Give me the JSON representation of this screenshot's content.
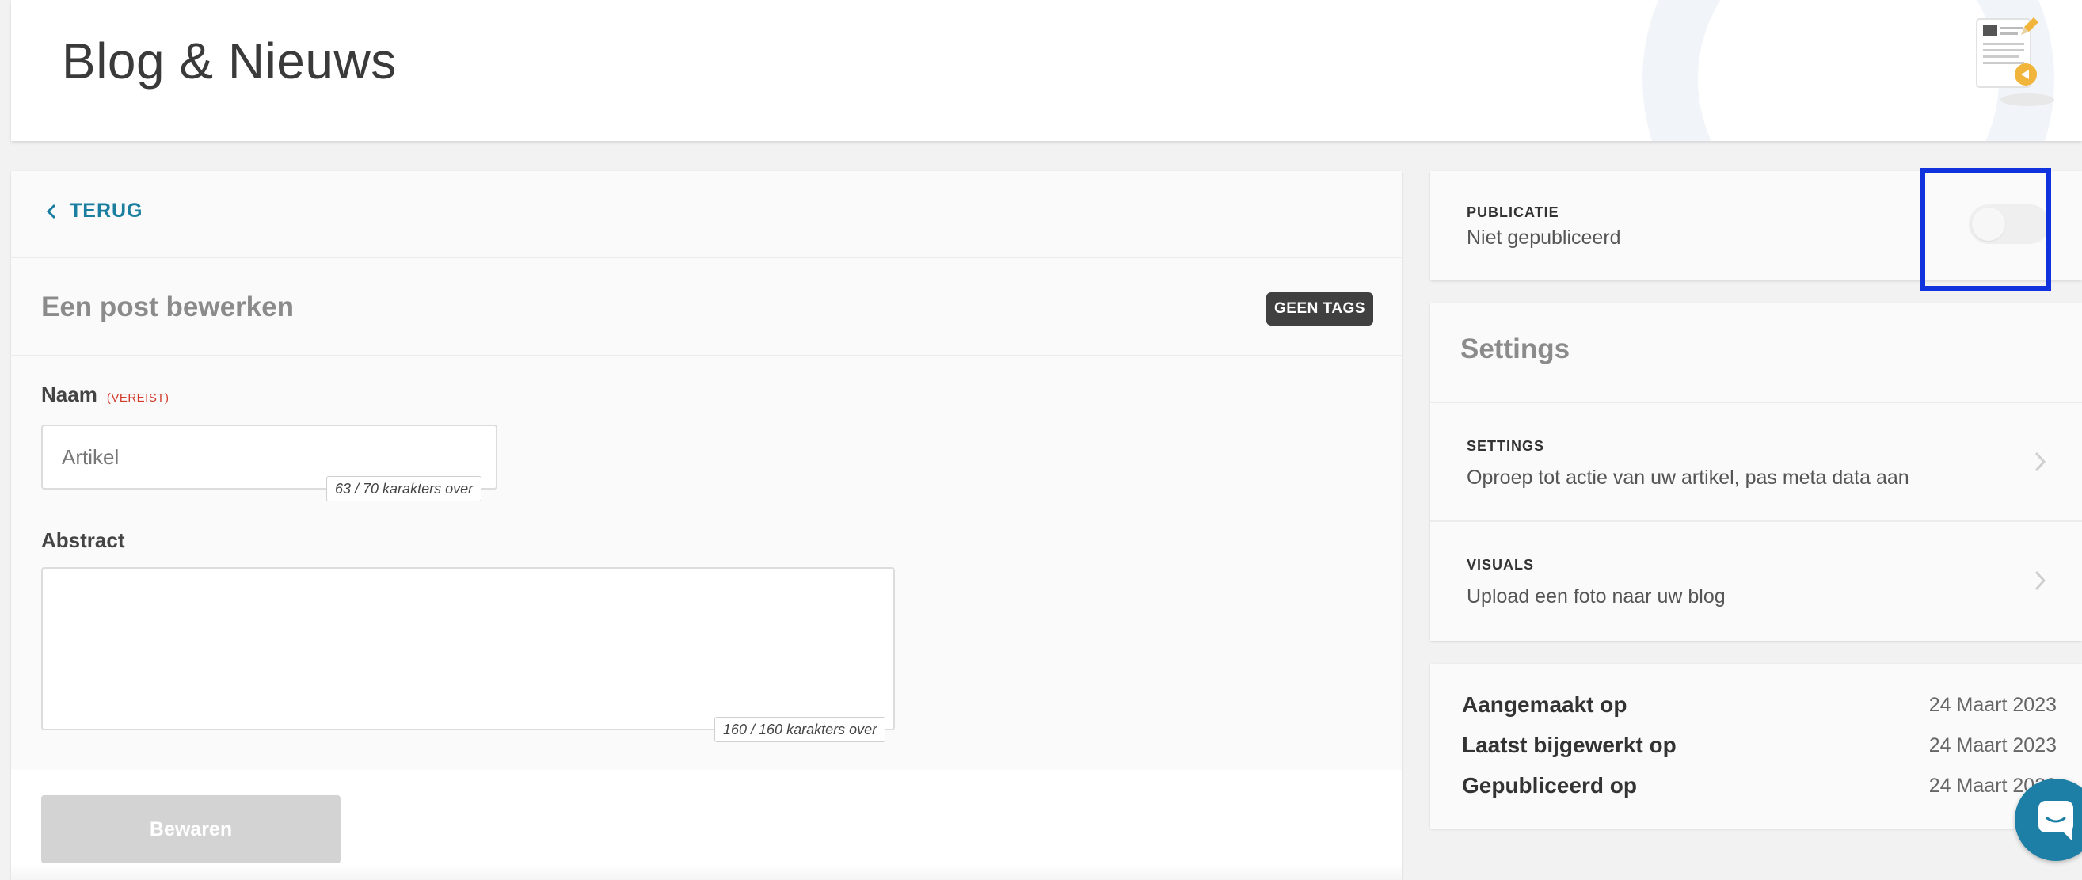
{
  "header": {
    "title": "Blog & Nieuws",
    "logo_icon": "blog-document-pencil-icon"
  },
  "editor": {
    "back_label": "TERUG",
    "title": "Een post bewerken",
    "tags_label": "GEEN TAGS",
    "name_field": {
      "label": "Naam",
      "required_label": "(VEREIST)",
      "value": "Artikel",
      "counter": "63 / 70 karakters over"
    },
    "abstract_field": {
      "label": "Abstract",
      "value": "",
      "counter": "160 / 160 karakters over"
    },
    "save_label": "Bewaren"
  },
  "publication": {
    "caption": "PUBLICATIE",
    "status": "Niet gepubliceerd",
    "published": false
  },
  "settings": {
    "title": "Settings",
    "items": [
      {
        "caption": "SETTINGS",
        "description": "Oproep tot actie van uw artikel, pas meta data aan"
      },
      {
        "caption": "VISUALS",
        "description": "Upload een foto naar uw blog"
      }
    ]
  },
  "dates": [
    {
      "label": "Aangemaakt op",
      "value": "24 Maart 2023"
    },
    {
      "label": "Laatst bijgewerkt op",
      "value": "24 Maart 2023"
    },
    {
      "label": "Gepubliceerd op",
      "value": "24 Maart 2023"
    }
  ],
  "colors": {
    "accent": "#1b7ea0",
    "required": "#d23a2a",
    "highlight": "#1133dd",
    "badge": "#404040"
  }
}
